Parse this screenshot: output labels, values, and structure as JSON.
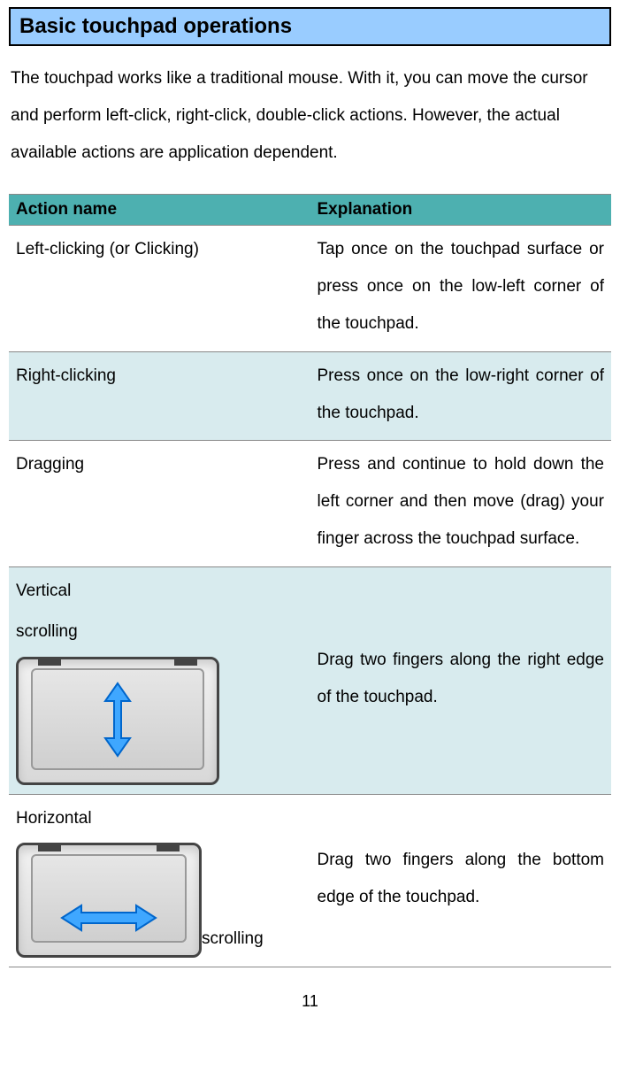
{
  "section_title": "Basic touchpad operations",
  "intro": "The touchpad works like a traditional mouse. With it, you can move the cursor and perform left-click, right-click, double-click actions. However, the actual available actions are application dependent.",
  "table": {
    "headers": {
      "action": "Action name",
      "explanation": "Explanation"
    },
    "rows": [
      {
        "action": "Left-clicking (or Clicking)",
        "explanation": "Tap once on the touchpad surface or press once on the low-left corner of the touchpad."
      },
      {
        "action": "Right-clicking",
        "explanation": "Press once on the low-right corner of the touchpad."
      },
      {
        "action": "Dragging",
        "explanation": "Press and continue to hold down the left corner and then move (drag) your finger across the touchpad surface."
      },
      {
        "action_line1": "Vertical",
        "action_line2": "scrolling",
        "explanation": "Drag two fingers along the right edge of the  touchpad."
      },
      {
        "action_line1": "Horizontal",
        "action_line2": "scrolling",
        "explanation": "Drag two fingers along the bottom edge of the touchpad."
      }
    ]
  },
  "page_number": "11"
}
